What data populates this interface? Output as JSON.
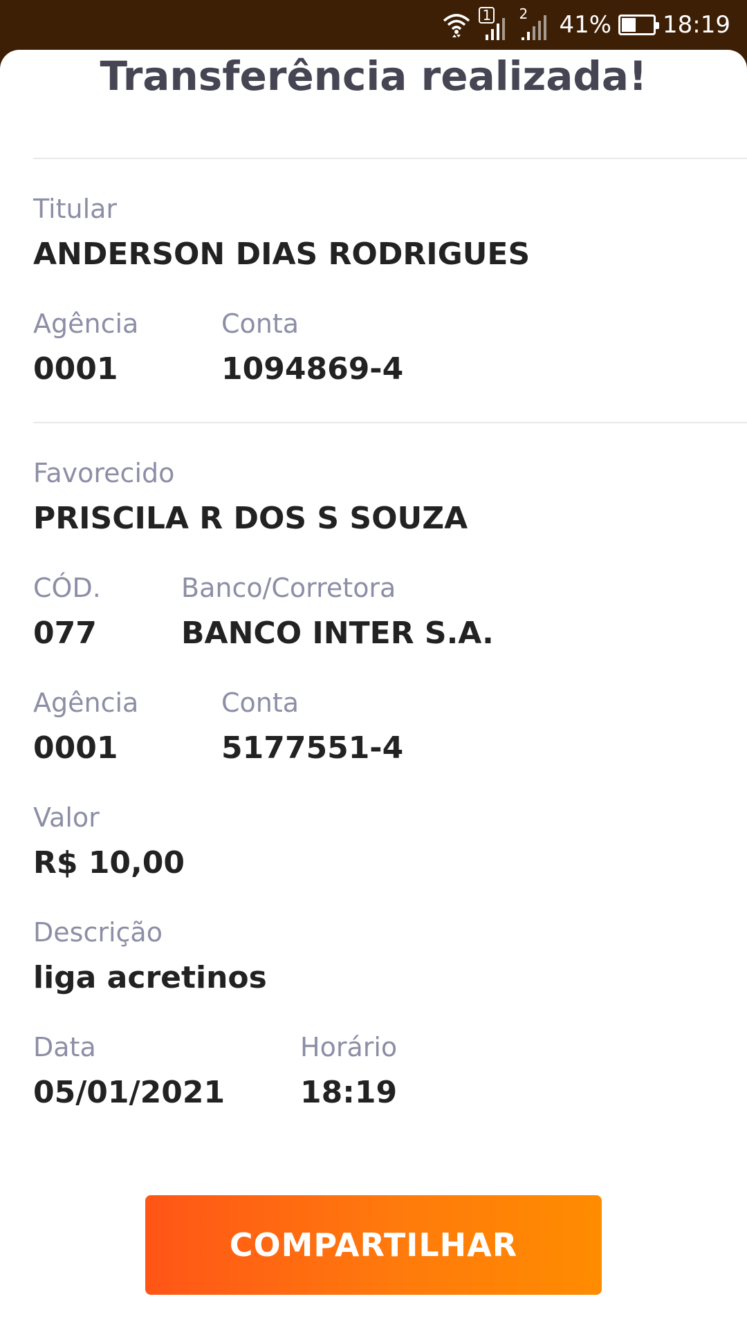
{
  "status_bar": {
    "battery_percent_text": "41%",
    "battery_level": 0.41,
    "time": "18:19",
    "sim1_label": "1",
    "sim2_label": "2",
    "icons": [
      "wifi-icon",
      "signal-sim1-icon",
      "signal-sim2-icon",
      "battery-icon"
    ]
  },
  "header": {
    "title": "Transferência realizada!"
  },
  "sender": {
    "holder_label": "Titular",
    "holder_name": "ANDERSON DIAS RODRIGUES",
    "agency_label": "Agência",
    "agency": "0001",
    "account_label": "Conta",
    "account": "1094869-4"
  },
  "recipient": {
    "payee_label": "Favorecido",
    "payee_name": "PRISCILA R DOS S SOUZA",
    "code_label": "CÓD.",
    "code": "077",
    "bank_label": "Banco/Corretora",
    "bank": "BANCO INTER S.A.",
    "agency_label": "Agência",
    "agency": "0001",
    "account_label": "Conta",
    "account": "5177551-4"
  },
  "details": {
    "amount_label": "Valor",
    "amount": "R$ 10,00",
    "description_label": "Descrição",
    "description": "liga acretinos",
    "date_label": "Data",
    "date": "05/01/2021",
    "time_label": "Horário",
    "time": "18:19"
  },
  "actions": {
    "share_label": "COMPARTILHAR"
  },
  "colors": {
    "status_bar_bg": "#3d1f05",
    "label": "#8c8ea6",
    "value": "#222222",
    "title": "#454553",
    "button_start": "#ff5517",
    "button_end": "#ff8c00"
  }
}
